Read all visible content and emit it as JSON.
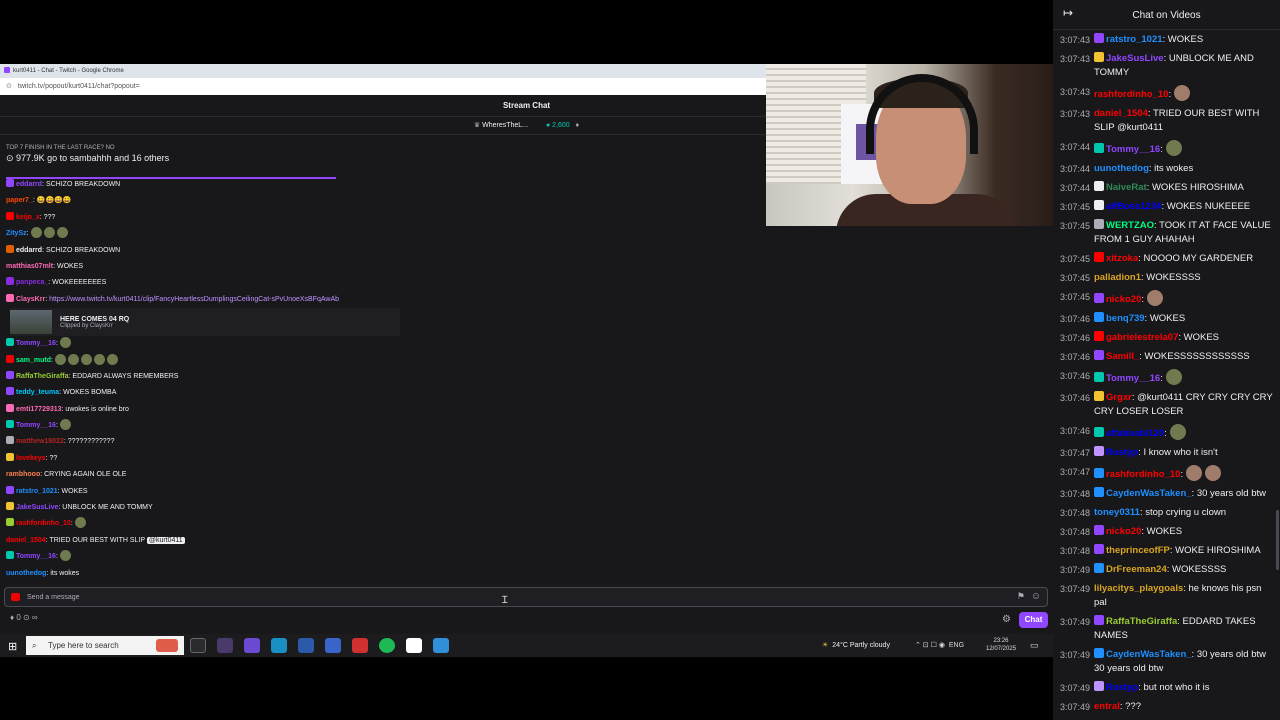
{
  "browser": {
    "window_title": "kurt0411 - Chat - Twitch - Google Chrome",
    "url": "twitch.tv/popout/kurt0411/chat?popout="
  },
  "stream_chat": {
    "header": "Stream Chat",
    "gift_user": "WheresTheL...",
    "bits": "2,600",
    "prediction_title": "TOP 7 FINISH IN THE LAST RACE? NO",
    "prediction_detail": "977.9K go to sambahhh and 16 others",
    "messages": [
      {
        "user": "eddarrd",
        "color": "#9146ff",
        "badge": "#9146ff",
        "text": ": SCHIZO BREAKDOWN",
        "emotes": 0
      },
      {
        "user": "paper7_",
        "color": "#ff4500",
        "badge": "",
        "text": ": 😀😀😀😀",
        "emotes": 0
      },
      {
        "user": "keijo_x",
        "color": "#ff0000",
        "badge": "#ff0000",
        "text": ": ???",
        "emotes": 0
      },
      {
        "user": "ZitySz",
        "color": "#1e90ff",
        "badge": "",
        "text": ":",
        "emotes": 3
      },
      {
        "user": "eddarrd",
        "color": "#efeff1",
        "badge": "#e05d00",
        "text": ": SCHIZO BREAKDOWN",
        "emotes": 0
      },
      {
        "user": "matthias07mlt",
        "color": "#ff69b4",
        "badge": "",
        "text": ": WOKES",
        "emotes": 0
      },
      {
        "user": "panpeca_",
        "color": "#8a2be2",
        "badge": "#8a2be2",
        "text": ": WOKEEEEEEES",
        "emotes": 0
      },
      {
        "user": "ClaysKrr",
        "color": "#ff69b4",
        "badge": "#ff69b4",
        "text": ": ",
        "link": "https://www.twitch.tv/kurt0411/clip/FancyHeartlessDumplingsCeilingCat-sPvUnoeXsBFqAwAb",
        "emotes": 0
      }
    ],
    "clip": {
      "title": "HERE COMES 04 RQ",
      "sub": "Clipped by ClaysKrr"
    },
    "messages2": [
      {
        "user": "Tommy__16",
        "color": "#9146ff",
        "badge": "#00c8af",
        "text": ":",
        "emotes": 1
      },
      {
        "user": "sam_mutd",
        "color": "#00ff7f",
        "badge": "#eb0400",
        "text": ":",
        "emotes": 5
      },
      {
        "user": "RaffaTheGiraffa",
        "color": "#9acd32",
        "badge": "#9146ff",
        "text": ": EDDARD ALWAYS REMEMBERS",
        "emotes": 0
      },
      {
        "user": "teddy_teuma",
        "color": "#00c8ff",
        "badge": "#9146ff",
        "text": ": WOKES BOMBA",
        "emotes": 0
      },
      {
        "user": "emti17729313",
        "color": "#ff69b4",
        "badge": "#ff69b4",
        "text": ": uwokes is online bro",
        "emotes": 0
      },
      {
        "user": "Tommy__16",
        "color": "#9146ff",
        "badge": "#00c8af",
        "text": ":",
        "emotes": 1
      },
      {
        "user": "matthew18022",
        "color": "#b22222",
        "badge": "#adadb8",
        "text": ": ????????????",
        "emotes": 0
      },
      {
        "user": "lovekeys",
        "color": "#ff0000",
        "badge": "#f1c232",
        "text": ": ??",
        "emotes": 0
      },
      {
        "user": "rambhooo",
        "color": "#ff7f50",
        "badge": "",
        "text": ": CRYING AGAIN OLE OLE",
        "emotes": 0
      },
      {
        "user": "ratstro_1021",
        "color": "#1e90ff",
        "badge": "#9146ff",
        "text": ": WOKES",
        "emotes": 0
      },
      {
        "user": "JakeSusLive",
        "color": "#9146ff",
        "badge": "#f1c232",
        "text": ": UNBLOCK ME AND TOMMY",
        "emotes": 0
      },
      {
        "user": "rashfordinho_10",
        "color": "#ff0000",
        "badge": "#9acd32",
        "text": ":",
        "emotes": 1
      },
      {
        "user": "daniel_1504",
        "color": "#ff0000",
        "badge": "",
        "text": ": TRIED OUR BEST WITH SLIP",
        "mention": "@kurt0411",
        "emotes": 0
      },
      {
        "user": "Tommy__16",
        "color": "#9146ff",
        "badge": "#00c8af",
        "text": ":",
        "emotes": 1
      },
      {
        "user": "uunothedog",
        "color": "#1e90ff",
        "badge": "",
        "text": ": its wokes",
        "emotes": 0
      }
    ],
    "input_placeholder": "Send a message",
    "points": "0",
    "chat_button": "Chat"
  },
  "taskbar": {
    "search_placeholder": "Type here to search",
    "weather": "24°C  Partly cloudy",
    "lang": "ENG",
    "time": "23:26",
    "date": "12/07/2025"
  },
  "side_chat": {
    "title": "Chat on Videos",
    "messages": [
      {
        "ts": "3:07:43",
        "user": "ratstro_1021",
        "color": "#1e90ff",
        "badge": "#9146ff",
        "text": ": WOKES",
        "emotes": 0
      },
      {
        "ts": "3:07:43",
        "user": "JakeSusLive",
        "color": "#9146ff",
        "badge": "#f1c232",
        "text": ": UNBLOCK ME AND TOMMY",
        "emotes": 0
      },
      {
        "ts": "3:07:43",
        "user": "rashfordinho_10",
        "color": "#ff0000",
        "badge": "",
        "text": ":",
        "emotes": 1,
        "face": true
      },
      {
        "ts": "3:07:43",
        "user": "daniel_1504",
        "color": "#ff0000",
        "badge": "",
        "text": ": TRIED OUR BEST WITH SLIP @kurt0411",
        "emotes": 0
      },
      {
        "ts": "3:07:44",
        "user": "Tommy__16",
        "color": "#9146ff",
        "badge": "#00c8af",
        "text": ":",
        "emotes": 1
      },
      {
        "ts": "3:07:44",
        "user": "uunothedog",
        "color": "#1e90ff",
        "badge": "",
        "text": ": its wokes",
        "emotes": 0
      },
      {
        "ts": "3:07:44",
        "user": "NaiveRat",
        "color": "#2e8b57",
        "badge": "#efeff1",
        "text": ": WOKES HIROSHIMA",
        "emotes": 0
      },
      {
        "ts": "3:07:45",
        "user": "alfBoss1234",
        "color": "#0000ff",
        "badge": "#efeff1",
        "text": ": WOKES NUKEEEE",
        "emotes": 0
      },
      {
        "ts": "3:07:45",
        "user": "WERTZAO",
        "color": "#00ff7f",
        "badge": "#adadb8",
        "text": ": TOOK IT AT FACE VALUE FROM 1 GUY AHAHAH",
        "emotes": 0
      },
      {
        "ts": "3:07:45",
        "user": "xitzoka",
        "color": "#ff0000",
        "badge": "#ff0000",
        "text": ": NOOOO MY GARDENER",
        "emotes": 0
      },
      {
        "ts": "3:07:45",
        "user": "palladion1",
        "color": "#daa520",
        "badge": "",
        "text": ": WOKESSSS",
        "emotes": 0
      },
      {
        "ts": "3:07:45",
        "user": "nicko20",
        "color": "#ff0000",
        "badge": "#9146ff",
        "text": ":",
        "emotes": 1,
        "face": true
      },
      {
        "ts": "3:07:46",
        "user": "benq739",
        "color": "#1e90ff",
        "badge": "#1e90ff",
        "text": ": WOKES",
        "emotes": 0
      },
      {
        "ts": "3:07:46",
        "user": "gabrielestrela07",
        "color": "#ff0000",
        "badge": "#ff0000",
        "text": ": WOKES",
        "emotes": 0
      },
      {
        "ts": "3:07:46",
        "user": "Samill_",
        "color": "#ff0000",
        "badge": "#9146ff",
        "text": ": WOKESSSSSSSSSSSS",
        "emotes": 0
      },
      {
        "ts": "3:07:46",
        "user": "Tommy__16",
        "color": "#9146ff",
        "badge": "#00c8af",
        "text": ":",
        "emotes": 1
      },
      {
        "ts": "3:07:46",
        "user": "Grgxr",
        "color": "#ff0000",
        "badge": "#f1c232",
        "text": ": @kurt0411 CRY CRY CRY CRY CRY LOSER LOSER",
        "emotes": 0
      },
      {
        "ts": "3:07:46",
        "user": "aftabnabi120",
        "color": "#0000ff",
        "badge": "#00c8af",
        "text": ":",
        "emotes": 1
      },
      {
        "ts": "3:07:47",
        "user": "Rustyp",
        "color": "#0000ff",
        "badge": "#bf94ff",
        "text": ": I know who it isn't",
        "emotes": 0
      },
      {
        "ts": "3:07:47",
        "user": "rashfordinho_10",
        "color": "#ff0000",
        "badge": "#1e90ff",
        "text": ":",
        "emotes": 2,
        "face": true
      },
      {
        "ts": "3:07:48",
        "user": "CaydenWasTaken_",
        "color": "#1e90ff",
        "badge": "#1e90ff",
        "text": ": 30 years old btw",
        "emotes": 0
      },
      {
        "ts": "3:07:48",
        "user": "toney0311",
        "color": "#1e90ff",
        "badge": "",
        "text": ": stop crying u clown",
        "emotes": 0
      },
      {
        "ts": "3:07:48",
        "user": "nicko20",
        "color": "#ff0000",
        "badge": "#9146ff",
        "text": ": WOKES",
        "emotes": 0
      },
      {
        "ts": "3:07:48",
        "user": "theprinceofFP",
        "color": "#daa520",
        "badge": "#9146ff",
        "text": ": WOKE HIROSHIMA",
        "emotes": 0
      },
      {
        "ts": "3:07:49",
        "user": "DrFreeman24",
        "color": "#daa520",
        "badge": "#1e90ff",
        "text": ": WOKESSSS",
        "emotes": 0
      },
      {
        "ts": "3:07:49",
        "user": "lilyacitys_playgoals",
        "color": "#daa520",
        "badge": "",
        "text": ": he knows his psn pal",
        "emotes": 0
      },
      {
        "ts": "3:07:49",
        "user": "RaffaTheGiraffa",
        "color": "#9acd32",
        "badge": "#9146ff",
        "text": ": EDDARD TAKES NAMES",
        "emotes": 0
      },
      {
        "ts": "3:07:49",
        "user": "CaydenWasTaken_",
        "color": "#1e90ff",
        "badge": "#1e90ff",
        "text": ": 30 years old btw 30 years old btw",
        "emotes": 0
      },
      {
        "ts": "3:07:49",
        "user": "Rustyp",
        "color": "#0000ff",
        "badge": "#bf94ff",
        "text": ": but not who it is",
        "emotes": 0
      },
      {
        "ts": "3:07:49",
        "user": "entral",
        "color": "#ff0000",
        "badge": "",
        "text": ": ???",
        "emotes": 0
      }
    ]
  }
}
